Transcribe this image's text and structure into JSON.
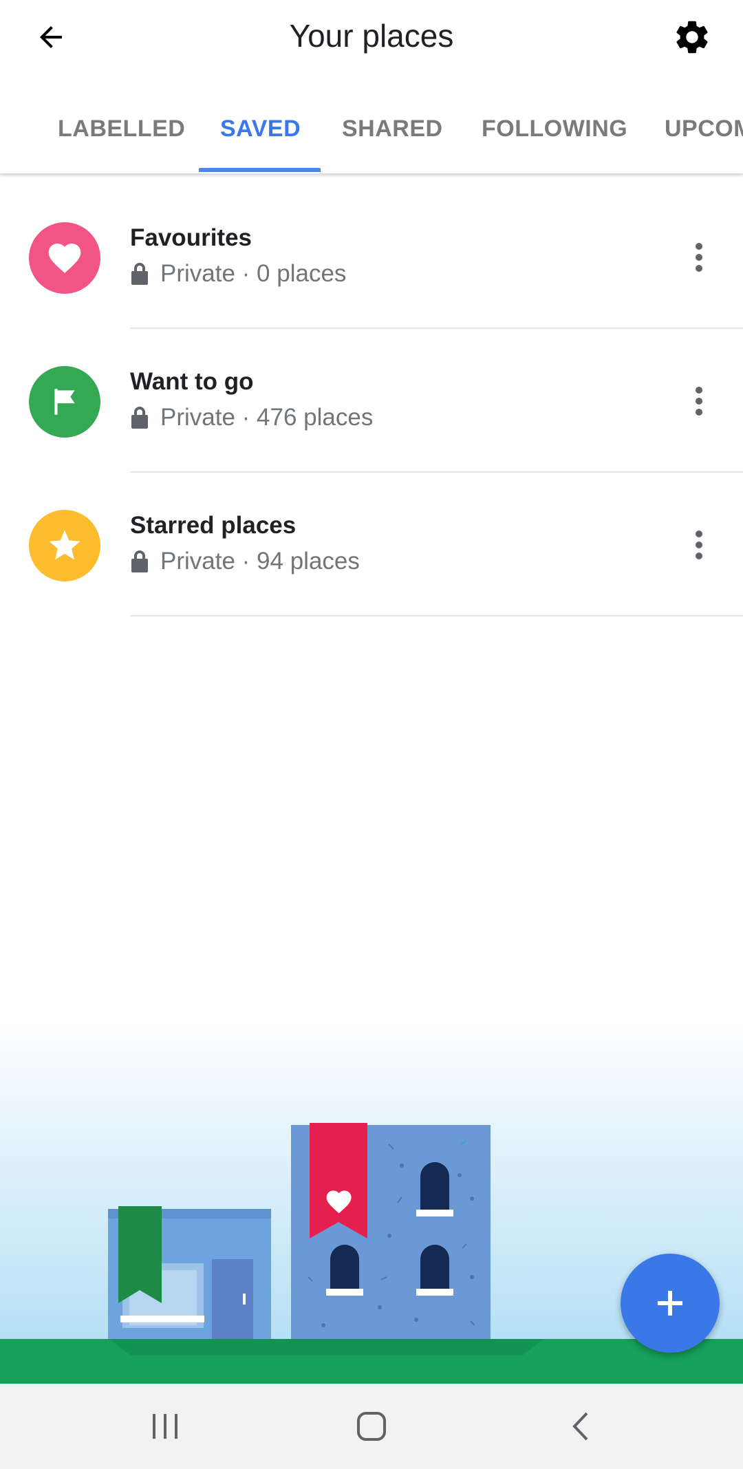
{
  "header": {
    "title": "Your places",
    "back_icon": "arrow-back-icon",
    "settings_icon": "gear-icon"
  },
  "tabs": [
    {
      "label": "LABELLED",
      "active": false
    },
    {
      "label": "SAVED",
      "active": true
    },
    {
      "label": "SHARED",
      "active": false
    },
    {
      "label": "FOLLOWING",
      "active": false
    },
    {
      "label": "UPCOMING",
      "active": false
    }
  ],
  "lists": [
    {
      "name": "Favourites",
      "visibility": "Private",
      "count": "· 0 places",
      "icon": "heart-icon",
      "color": "#f25585"
    },
    {
      "name": "Want to go",
      "visibility": "Private",
      "count": "· 476 places",
      "icon": "flag-icon",
      "color": "#34a853"
    },
    {
      "name": "Starred places",
      "visibility": "Private",
      "count": "· 94 places",
      "icon": "star-icon",
      "color": "#fbbc2e"
    }
  ],
  "fab": {
    "icon": "plus-icon",
    "color": "#3b78e7"
  },
  "navbar": {
    "recents_icon": "recents-icon",
    "home_icon": "home-icon",
    "back_icon": "nav-back-icon"
  },
  "colors": {
    "accent": "#4a86e8",
    "tab_inactive": "#7a7a7a",
    "ground": "#16a05a"
  }
}
